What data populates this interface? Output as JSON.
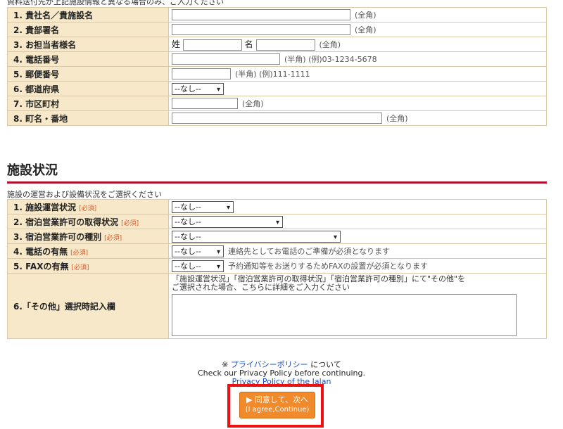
{
  "top_note": "資料送付先が上記施設情報と異なる場合のみ、ご入力ください",
  "contact_rows": [
    {
      "label": "1. 貴社名／貴施設名",
      "hint": "(全角)"
    },
    {
      "label": "2. 貴部署名",
      "hint": "(全角)"
    },
    {
      "label": "3. お担当者様名",
      "sei": "姓",
      "mei": "名",
      "hint": "(全角)"
    },
    {
      "label": "4. 電話番号",
      "hint": "(半角) (例)03-1234-5678"
    },
    {
      "label": "5. 郵便番号",
      "hint": "(半角) (例)111-1111"
    },
    {
      "label": "6. 都道府県",
      "select": "--なし--"
    },
    {
      "label": "7. 市区町村",
      "hint": "(全角)"
    },
    {
      "label": "8. 町名・番地",
      "hint": "(全角)"
    }
  ],
  "section": {
    "title": "施設状況",
    "note": "施設の運営および設備状況をご選択ください"
  },
  "required_mark": "[必須]",
  "facility_rows": [
    {
      "label": "1. 施設運営状況",
      "select": "--なし--"
    },
    {
      "label": "2. 宿泊営業許可の取得状況",
      "select": "--なし--"
    },
    {
      "label": "3. 宿泊営業許可の種別",
      "select": "--なし--"
    },
    {
      "label": "4. 電話の有無",
      "select": "--なし--",
      "hint": "連絡先としてお電話のご準備が必須となります"
    },
    {
      "label": "5. FAXの有無",
      "select": "--なし--",
      "hint": "予約通知等をお送りするためFAXの設置が必須となります"
    },
    {
      "label": "6.「その他」選択時記入欄",
      "note_line1": "「施設運営状況」「宿泊営業許可の取得状況」「宿泊営業許可の種別」にて\"その他\"を",
      "note_line2": "ご選択された場合、こちらに詳細をご入力ください"
    }
  ],
  "privacy": {
    "mark": "※",
    "link": "プライバシーポリシー",
    "suffix": " について",
    "en_line": "Check our Privacy Policy before continuing.",
    "en_link": "Privacy Policy of the Jalan"
  },
  "agree_button": {
    "label": "▶ 同意して、次へ",
    "sub": "(I agree,Continue)"
  },
  "colors": {
    "label_bg": "#f6e8c8",
    "rule": "#b0102a",
    "button": "#f08a2a",
    "highlight": "#ee1111",
    "link": "#1a4fc0"
  }
}
